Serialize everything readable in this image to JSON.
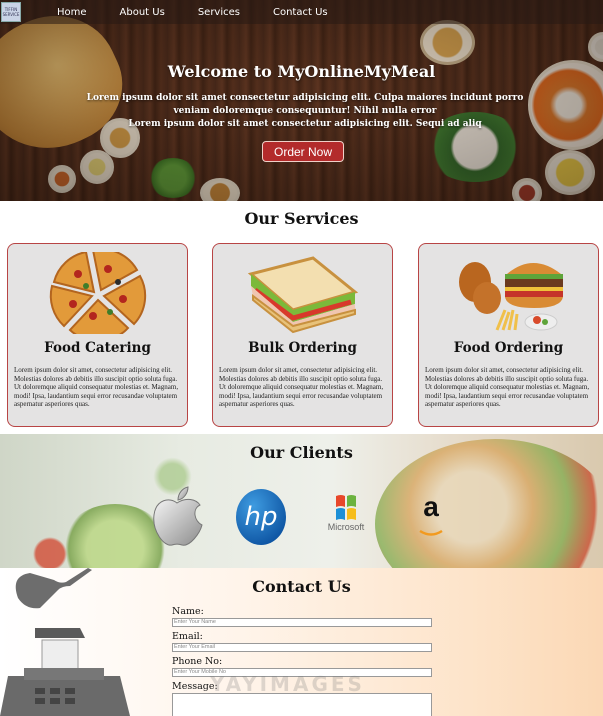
{
  "nav": {
    "logo_text": "TIFFIN SERVICE",
    "links": [
      {
        "label": "Home"
      },
      {
        "label": "About Us"
      },
      {
        "label": "Services"
      },
      {
        "label": "Contact Us"
      }
    ]
  },
  "hero": {
    "title": "Welcome to MyOnlineMyMeal",
    "line1": "Lorem ipsum dolor sit amet consectetur adipisicing elit. Culpa maiores incidunt porro veniam doloremque consequuntur! Nihil nulla error",
    "line2": "Lorem ipsum dolor sit amet consectetur adipisicing elit. Sequi ad aliq",
    "button": "Order Now"
  },
  "services": {
    "title": "Our Services",
    "cards": [
      {
        "title": "Food Catering",
        "image": "pizza-image",
        "text": "Lorem ipsum dolor sit amet, consectetur adipisicing elit. Molestias dolores ab debitis illo suscipit optio soluta fuga. Ut doloremque aliquid consequatur molestias et. Magnam, modi! Ipsa, laudantium sequi error recusandae voluptatem aspernatur asperiores quas."
      },
      {
        "title": "Bulk Ordering",
        "image": "sandwich-image",
        "text": "Lorem ipsum dolor sit amet, consectetur adipisicing elit. Molestias dolores ab debitis illo suscipit optio soluta fuga. Ut doloremque aliquid consequatur molestias et. Magnam, modi! Ipsa, laudantium sequi error recusandae voluptatem aspernatur asperiores quas."
      },
      {
        "title": "Food Ordering",
        "image": "burger-image",
        "text": "Lorem ipsum dolor sit amet, consectetur adipisicing elit. Molestias dolores ab debitis illo suscipit optio soluta fuga. Ut doloremque aliquid consequatur molestias et. Magnam, modi! Ipsa, laudantium sequi error recusandae voluptatem aspernatur asperiores quas."
      }
    ]
  },
  "clients": {
    "title": "Our Clients",
    "logos": [
      {
        "name": "apple-logo",
        "label": ""
      },
      {
        "name": "hp-logo",
        "label": "hp"
      },
      {
        "name": "microsoft-logo",
        "label": "Microsoft"
      },
      {
        "name": "amazon-logo",
        "label": "a"
      }
    ]
  },
  "contact": {
    "title": "Contact Us",
    "fields": {
      "name_label": "Name:",
      "name_placeholder": "Enter Your Name",
      "email_label": "Email:",
      "email_placeholder": "Enter Your Email",
      "phone_label": "Phone No:",
      "phone_placeholder": "Enter Your Mobile No",
      "message_label": "Message:"
    },
    "watermark": "YAYIMAGES"
  },
  "colors": {
    "accent": "#b32b2b",
    "card_border": "#b84545",
    "card_bg": "#e4e3e3"
  }
}
